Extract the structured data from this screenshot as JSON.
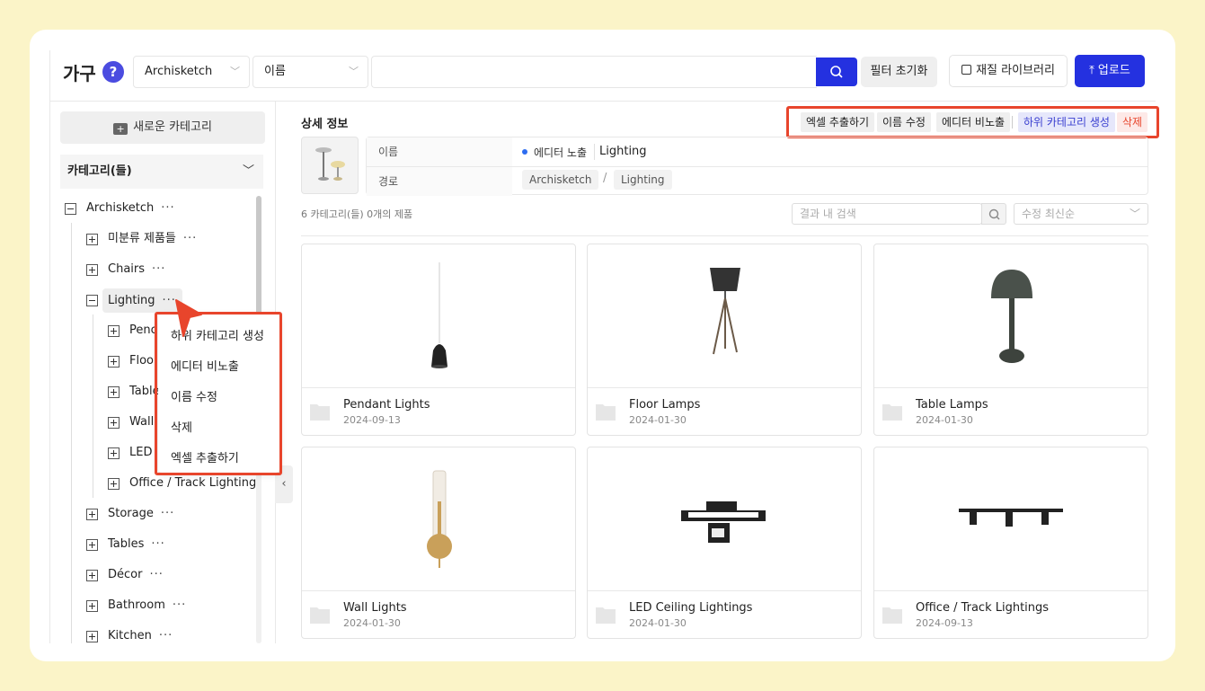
{
  "header": {
    "title": "가구",
    "help": "?",
    "library_select": "Archisketch",
    "field_select": "이름",
    "search_value": "",
    "reset_label": "필터 초기화",
    "material_label": "재질 라이브러리",
    "upload_label": "업로드"
  },
  "sidebar": {
    "new_category": "새로운 카테고리",
    "categories_label": "카테고리(들)",
    "root": "Archisketch",
    "items": [
      {
        "label": "미분류 제품들"
      },
      {
        "label": "Chairs"
      },
      {
        "label": "Lighting"
      },
      {
        "label": "Storage"
      },
      {
        "label": "Tables"
      },
      {
        "label": "Décor"
      },
      {
        "label": "Bathroom"
      },
      {
        "label": "Kitchen"
      }
    ],
    "lighting_children": [
      {
        "label": "Pendant Lights",
        "visible": "Penc"
      },
      {
        "label": "Floor Lamps",
        "visible": "Floo"
      },
      {
        "label": "Table Lamps",
        "visible": "Table"
      },
      {
        "label": "Wall Lights",
        "visible": "Wall"
      },
      {
        "label": "LED Ceiling Lightings",
        "visible": "LED"
      },
      {
        "label": "Office / Track Lightings",
        "visible": "Office / Track Lightings"
      }
    ],
    "dots": "···"
  },
  "context_menu": {
    "items": [
      "하위 카테고리 생성",
      "에디터 비노출",
      "이름 수정",
      "삭제",
      "엑셀 추출하기"
    ]
  },
  "detail": {
    "title": "상세 정보",
    "actions": [
      "엑셀 추출하기",
      "이름 수정",
      "에디터 비노출",
      "하위 카테고리 생성",
      "삭제"
    ],
    "name_label": "이름",
    "name_status": "에디터 노출",
    "name_value": "Lighting",
    "path_label": "경로",
    "path": [
      "Archisketch",
      "Lighting"
    ],
    "path_sep": "/"
  },
  "results": {
    "count_text": "6 카테고리(들) 0개의 제품",
    "search_placeholder": "결과 내 검색",
    "sort_label": "수정 최신순"
  },
  "cards": [
    {
      "name": "Pendant Lights",
      "date": "2024-09-13"
    },
    {
      "name": "Floor Lamps",
      "date": "2024-01-30"
    },
    {
      "name": "Table Lamps",
      "date": "2024-01-30"
    },
    {
      "name": "Wall Lights",
      "date": "2024-01-30"
    },
    {
      "name": "LED Ceiling Lightings",
      "date": "2024-01-30"
    },
    {
      "name": "Office / Track Lightings",
      "date": "2024-09-13"
    }
  ],
  "colors": {
    "accent": "#2431e0",
    "highlight": "#e8452c",
    "status_dot": "#2d6cf0"
  }
}
